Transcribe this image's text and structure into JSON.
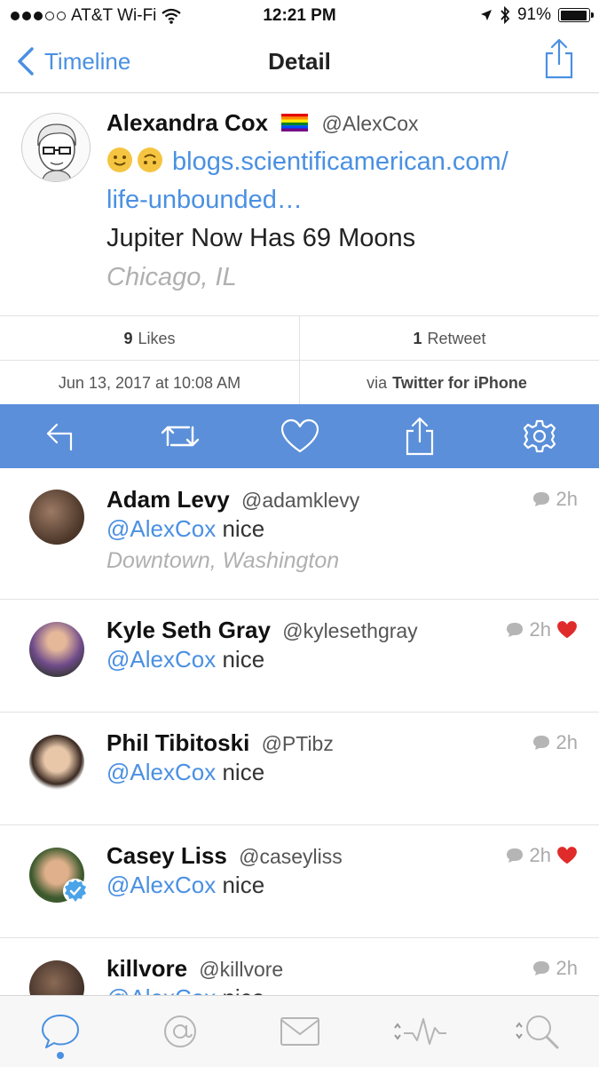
{
  "colors": {
    "accent": "#4a90e2",
    "action_bar": "#5b8fd9",
    "like_heart": "#e02b2b"
  },
  "status_bar": {
    "carrier": "AT&T Wi-Fi",
    "time": "12:21 PM",
    "battery": "91%",
    "signal_bars_filled": 3,
    "signal_bars_total": 5
  },
  "nav": {
    "back_label": "Timeline",
    "title": "Detail"
  },
  "tweet": {
    "author_name": "Alexandra Cox",
    "author_handle": "@AlexCox",
    "link_part1": "blogs.scientificamerican.com/",
    "link_part2": "life-unbounded…",
    "text": "Jupiter Now Has 69 Moons",
    "location": "Chicago, IL",
    "likes_count": "9",
    "likes_label": "Likes",
    "retweets_count": "1",
    "retweets_label": "Retweet",
    "timestamp": "Jun 13, 2017 at 10:08 AM",
    "via_prefix": "via",
    "client": "Twitter for iPhone"
  },
  "actions": [
    "reply-icon",
    "retweet-icon",
    "like-icon",
    "share-icon",
    "settings-icon"
  ],
  "replies": [
    {
      "name": "Adam Levy",
      "handle": "@adamklevy",
      "mention": "@AlexCox",
      "text": "nice",
      "location": "Downtown, Washington",
      "time": "2h",
      "liked": false
    },
    {
      "name": "Kyle Seth Gray",
      "handle": "@kylesethgray",
      "mention": "@AlexCox",
      "text": "nice",
      "time": "2h",
      "liked": true
    },
    {
      "name": "Phil Tibitoski",
      "handle": "@PTibz",
      "mention": "@AlexCox",
      "text": "nice",
      "time": "2h",
      "liked": false
    },
    {
      "name": "Casey Liss",
      "handle": "@caseyliss",
      "mention": "@AlexCox",
      "text": "nice",
      "time": "2h",
      "liked": true,
      "verified": true
    },
    {
      "name": "killvore",
      "handle": "@killvore",
      "mention": "@AlexCox",
      "text": "nice",
      "time": "2h",
      "liked": false
    }
  ],
  "tabs": [
    "timeline-tab",
    "mentions-tab",
    "messages-tab",
    "activity-tab",
    "search-tab"
  ]
}
